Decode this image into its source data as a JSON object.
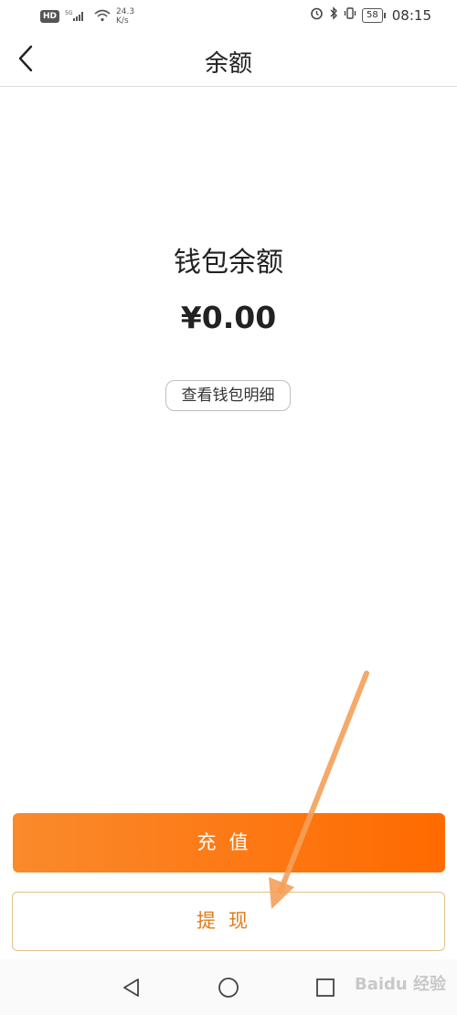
{
  "status_bar": {
    "hd": "HD",
    "net": "5G",
    "speed_value": "24.3",
    "speed_unit": "K/s",
    "battery": "58",
    "time": "08:15"
  },
  "header": {
    "title": "余额"
  },
  "wallet": {
    "label": "钱包余额",
    "amount": "¥0.00",
    "detail_button": "查看钱包明细"
  },
  "actions": {
    "recharge": "充值",
    "withdraw": "提现"
  },
  "watermark": "Baidu 经验",
  "colors": {
    "accent": "#ff7a1a",
    "withdraw_text": "#e07c1c",
    "arrow": "#f5a05a"
  }
}
